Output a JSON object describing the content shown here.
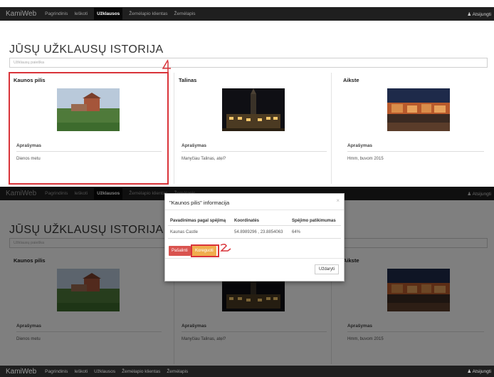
{
  "navbar": {
    "brand": "KamiWeb",
    "links": [
      "Pagrindinis",
      "Ieškoti",
      "Užklausos",
      "Žemėlapio klientas",
      "Žemėlapis"
    ],
    "active_index": 2,
    "user": "Atsijungti"
  },
  "page": {
    "title": "JŪSŲ UŽKLAUSŲ ISTORIJA",
    "search_placeholder": "Užklausų paieška"
  },
  "cards": [
    {
      "title": "Kaunos pilis",
      "desc_heading": "Aprašymas",
      "desc": "Dienos metu"
    },
    {
      "title": "Talinas",
      "desc_heading": "Aprašymas",
      "desc": "Manyčiau Talinas, ate̜i?"
    },
    {
      "title": "Aikste",
      "desc_heading": "Aprašymas",
      "desc": "Hmm, buvom 2015"
    }
  ],
  "modal": {
    "title": "\"Kaunos pilis\" informacija",
    "close_glyph": "×",
    "columns": [
      "Pavadinimas pagal spėjimą",
      "Koordinatės",
      "Spėjimo patikimumas"
    ],
    "row": [
      "Kaunas Castle",
      "54.8989296 , 23.8854063",
      "64%"
    ],
    "btn_delete": "Pašalinti",
    "btn_edit": "Koreguoti",
    "btn_close": "Uždaryti"
  },
  "annotations": [
    "1",
    "2"
  ],
  "colors": {
    "navbar": "#1f1f1f",
    "annotation_red": "#d9343a",
    "btn_delete": "#d9534f",
    "btn_edit": "#f0ad4e"
  },
  "icons": [
    "user-icon",
    "close-icon"
  ]
}
